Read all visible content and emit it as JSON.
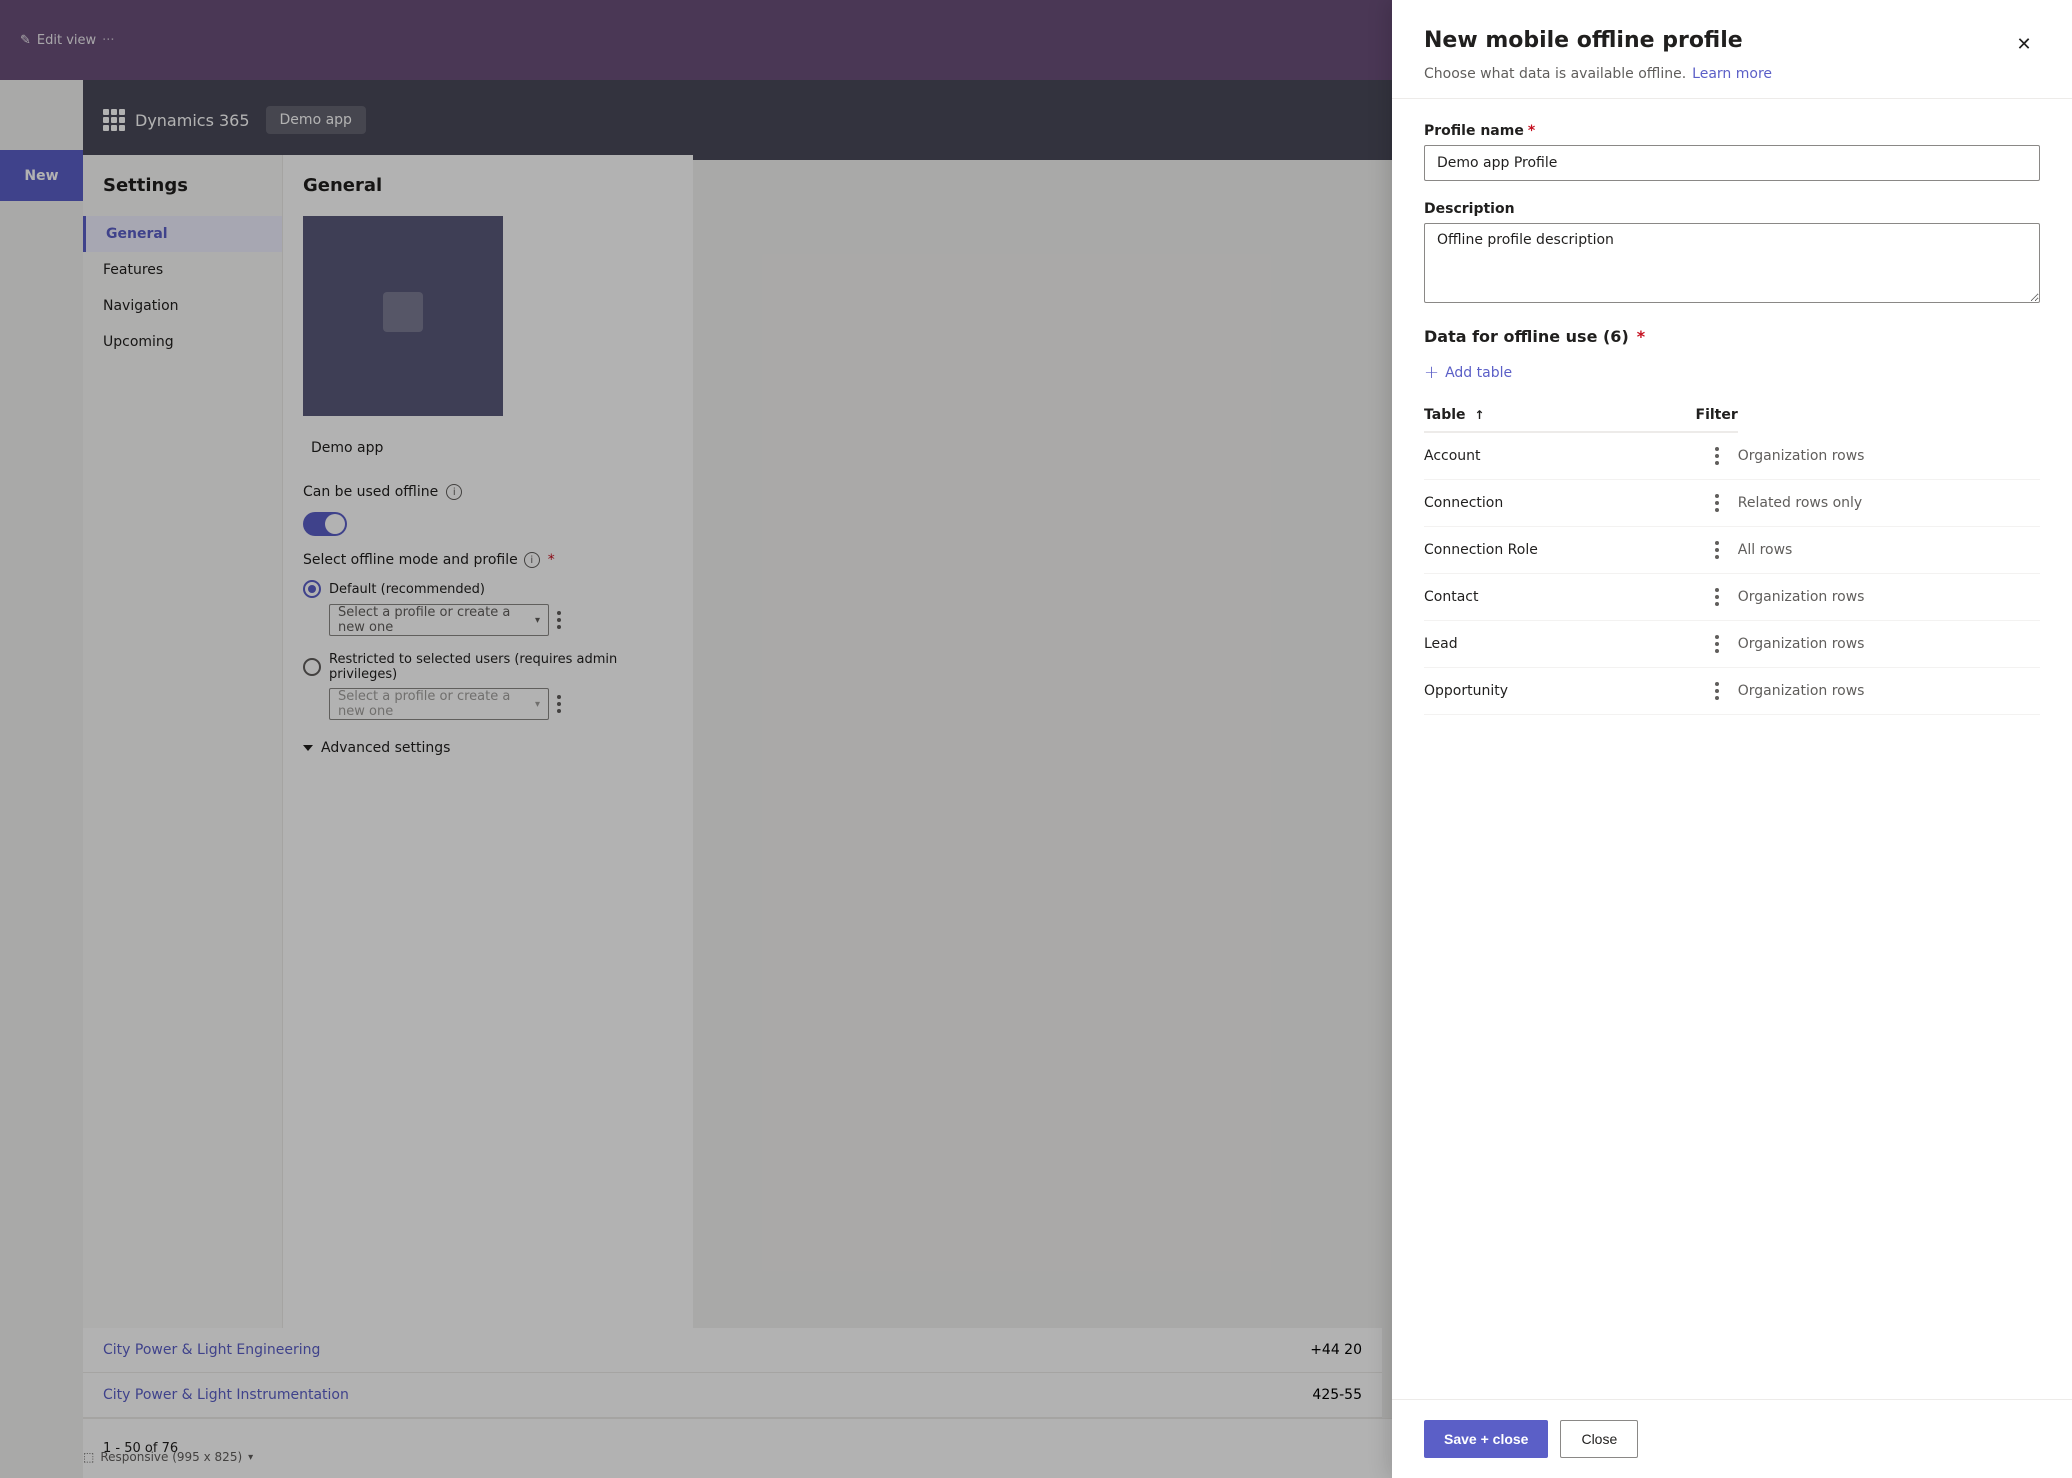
{
  "app": {
    "title": "Dynamics 365",
    "demo_app": "Demo app"
  },
  "topbar": {
    "edit_view": "Edit view",
    "new_button": "New"
  },
  "settings": {
    "title": "Settings",
    "nav_items": [
      {
        "label": "General",
        "active": true
      },
      {
        "label": "Features",
        "active": false
      },
      {
        "label": "Navigation",
        "active": false
      },
      {
        "label": "Upcoming",
        "active": false
      }
    ],
    "general_title": "General",
    "app_preview_name": "Demo app",
    "offline": {
      "can_be_used_label": "Can be used offline",
      "select_mode_label": "Select offline mode and profile",
      "options": [
        {
          "label": "Default (recommended)",
          "placeholder": "Select a profile or create a new one",
          "selected": true
        },
        {
          "label": "Restricted to selected users (requires admin privileges)",
          "placeholder": "Select a profile or create a new one",
          "selected": false
        }
      ]
    },
    "advanced_settings": "Advanced settings"
  },
  "list": {
    "rows": [
      {
        "name": "City Power & Light Engineering",
        "phone": "+44 20"
      },
      {
        "name": "City Power & Light Instrumentation",
        "phone": "425-55"
      }
    ],
    "pagination": "1 - 50 of 76"
  },
  "modal": {
    "title": "New mobile offline profile",
    "subtitle": "Choose what data is available offline.",
    "learn_more": "Learn more",
    "close_label": "✕",
    "fields": {
      "profile_name_label": "Profile name",
      "profile_name_required": true,
      "profile_name_value": "Demo app Profile",
      "description_label": "Description",
      "description_value": "Offline profile description"
    },
    "data_section": {
      "label": "Data for offline use (6)",
      "required": true,
      "add_table_label": "Add table",
      "table_header_name": "Table",
      "table_header_filter": "Filter",
      "rows": [
        {
          "table": "Account",
          "filter": "Organization rows"
        },
        {
          "table": "Connection",
          "filter": "Related rows only"
        },
        {
          "table": "Connection Role",
          "filter": "All rows"
        },
        {
          "table": "Contact",
          "filter": "Organization rows"
        },
        {
          "table": "Lead",
          "filter": "Organization rows"
        },
        {
          "table": "Opportunity",
          "filter": "Organization rows"
        }
      ]
    },
    "footer": {
      "save_close": "Save + close",
      "close": "Close"
    }
  },
  "responsive": {
    "label": "Responsive (995 x 825)"
  }
}
